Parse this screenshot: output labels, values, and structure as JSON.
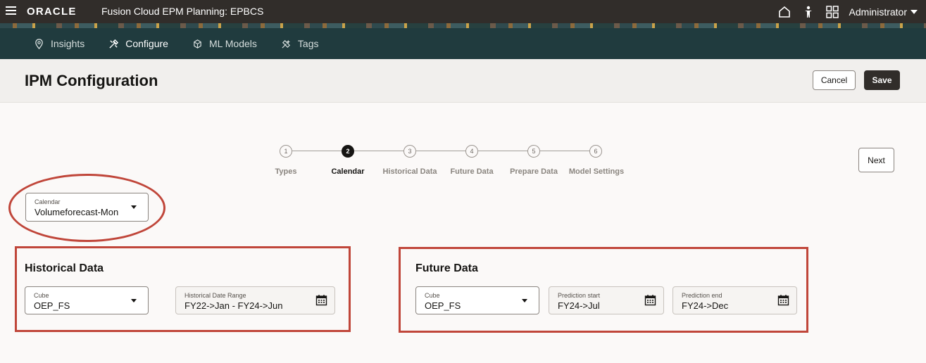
{
  "topbar": {
    "logo": "ORACLE",
    "app_title": "Fusion Cloud EPM Planning:  EPBCS",
    "user": "Administrator",
    "icons": [
      "home-icon",
      "accessibility-icon",
      "navigator-grid-icon"
    ]
  },
  "nav": {
    "items": [
      {
        "label": "Insights",
        "icon": "insights-icon"
      },
      {
        "label": "Configure",
        "icon": "configure-icon",
        "active": true
      },
      {
        "label": "ML Models",
        "icon": "ml-models-icon"
      },
      {
        "label": "Tags",
        "icon": "tags-icon"
      }
    ]
  },
  "header": {
    "title": "IPM Configuration",
    "cancel_label": "Cancel",
    "save_label": "Save"
  },
  "train": {
    "steps": [
      {
        "number": "1",
        "label": "Types"
      },
      {
        "number": "2",
        "label": "Calendar",
        "active": true
      },
      {
        "number": "3",
        "label": "Historical Data"
      },
      {
        "number": "4",
        "label": "Future Data"
      },
      {
        "number": "5",
        "label": "Prepare Data"
      },
      {
        "number": "6",
        "label": "Model Settings"
      }
    ],
    "next_label": "Next"
  },
  "calendar": {
    "label": "Calendar",
    "value": "Volumeforecast-Mon"
  },
  "historical": {
    "title": "Historical Data",
    "cube_label": "Cube",
    "cube_value": "OEP_FS",
    "range_label": "Historical Date Range",
    "range_value": "FY22->Jan - FY24->Jun"
  },
  "future": {
    "title": "Future Data",
    "cube_label": "Cube",
    "cube_value": "OEP_FS",
    "start_label": "Prediction start",
    "start_value": "FY24->Jul",
    "end_label": "Prediction end",
    "end_value": "FY24->Dec"
  },
  "colors": {
    "topbar": "#312d2a",
    "nav": "#203b3e",
    "annotation": "#c0463a"
  }
}
